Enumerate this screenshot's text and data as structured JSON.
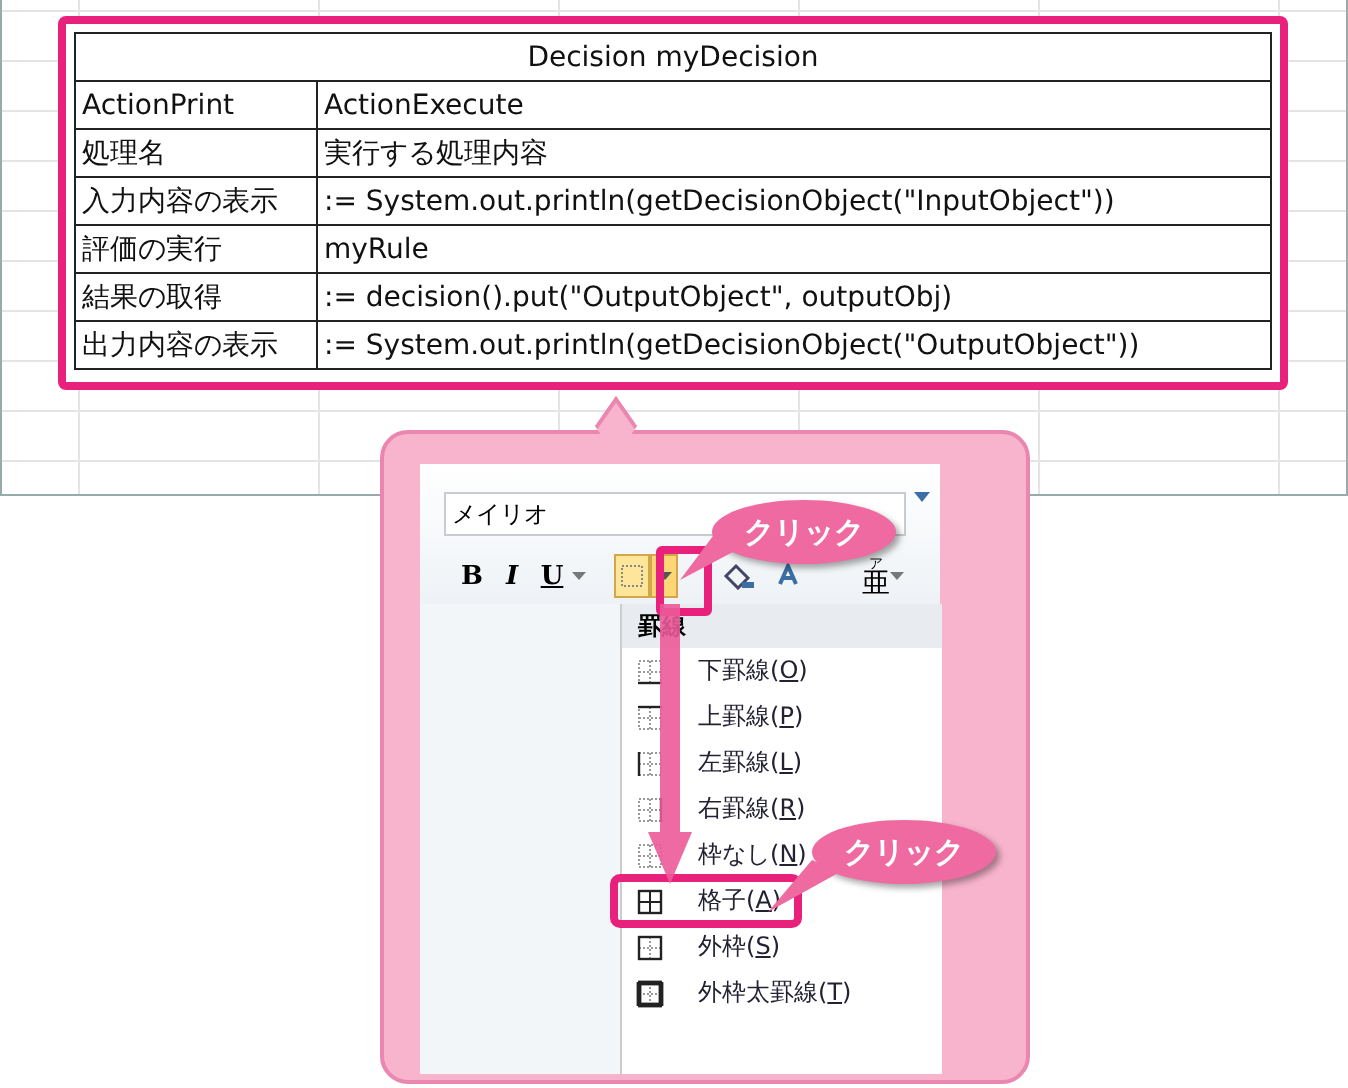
{
  "table": {
    "title": "Decision myDecision",
    "rows": [
      [
        "ActionPrint",
        "ActionExecute"
      ],
      [
        "処理名",
        "実行する処理内容"
      ],
      [
        "入力内容の表示",
        ":= System.out.println(getDecisionObject(\"InputObject\"))"
      ],
      [
        "評価の実行",
        "myRule"
      ],
      [
        "結果の取得",
        ":= decision().put(\"OutputObject\", outputObj)"
      ],
      [
        "出力内容の表示",
        ":= System.out.println(getDecisionObject(\"OutputObject\"))"
      ]
    ]
  },
  "font_field": {
    "value": "メイリオ"
  },
  "format_buttons": [
    "B",
    "I",
    "U"
  ],
  "phonetic_button": {
    "label": "亜",
    "ruby": "ア"
  },
  "border_menu": {
    "header": "罫線",
    "items": [
      {
        "label": "下罫線(O)",
        "kind": "bottom",
        "selected": false
      },
      {
        "label": "上罫線(P)",
        "kind": "top",
        "selected": false
      },
      {
        "label": "左罫線(L)",
        "kind": "left",
        "selected": false
      },
      {
        "label": "右罫線(R)",
        "kind": "right",
        "selected": false
      },
      {
        "label": "枠なし(N)",
        "kind": "none",
        "selected": false
      },
      {
        "label": "格子(A)",
        "kind": "all",
        "selected": true
      },
      {
        "label": "外枠(S)",
        "kind": "outside",
        "selected": false
      },
      {
        "label": "外枠太罫線(T)",
        "kind": "thick",
        "selected": false
      }
    ]
  },
  "callouts": [
    "クリック",
    "クリック"
  ]
}
